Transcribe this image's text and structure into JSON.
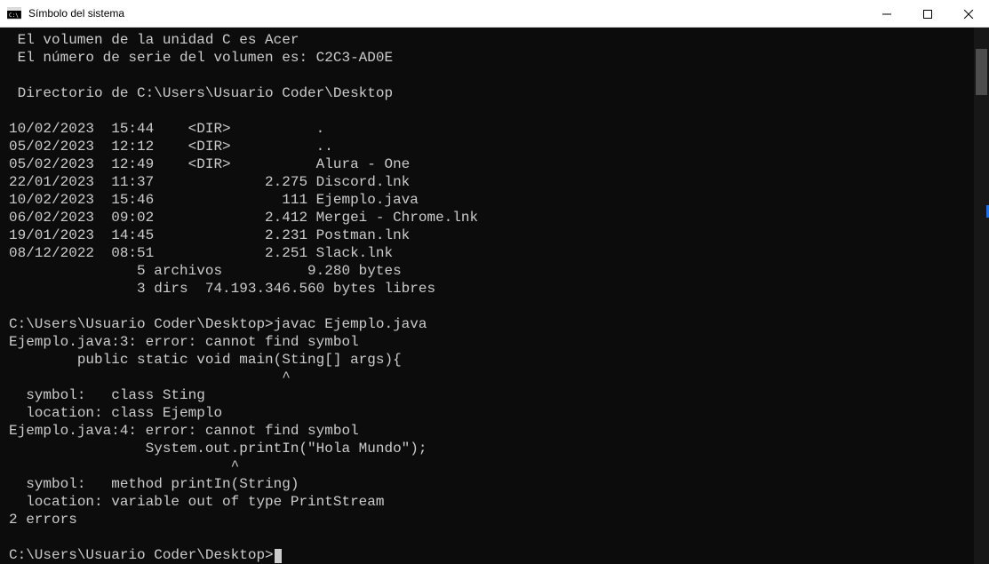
{
  "window": {
    "title": "Símbolo del sistema"
  },
  "terminal": {
    "lines": [
      " El volumen de la unidad C es Acer",
      " El número de serie del volumen es: C2C3-AD0E",
      "",
      " Directorio de C:\\Users\\Usuario Coder\\Desktop",
      "",
      "10/02/2023  15:44    <DIR>          .",
      "05/02/2023  12:12    <DIR>          ..",
      "05/02/2023  12:49    <DIR>          Alura - One",
      "22/01/2023  11:37             2.275 Discord.lnk",
      "10/02/2023  15:46               111 Ejemplo.java",
      "06/02/2023  09:02             2.412 Mergei - Chrome.lnk",
      "19/01/2023  14:45             2.231 Postman.lnk",
      "08/12/2022  08:51             2.251 Slack.lnk",
      "               5 archivos          9.280 bytes",
      "               3 dirs  74.193.346.560 bytes libres",
      "",
      "C:\\Users\\Usuario Coder\\Desktop>javac Ejemplo.java",
      "Ejemplo.java:3: error: cannot find symbol",
      "        public static void main(Sting[] args){",
      "                                ^",
      "  symbol:   class Sting",
      "  location: class Ejemplo",
      "Ejemplo.java:4: error: cannot find symbol",
      "                System.out.printIn(\"Hola Mundo\");",
      "                          ^",
      "  symbol:   method printIn(String)",
      "  location: variable out of type PrintStream",
      "2 errors",
      "",
      "C:\\Users\\Usuario Coder\\Desktop>"
    ]
  }
}
